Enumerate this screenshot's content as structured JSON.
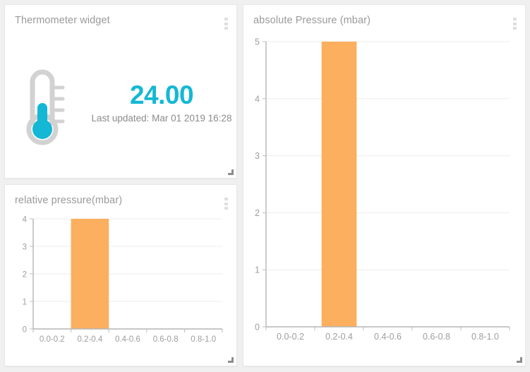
{
  "theme": {
    "page_background": "#f0f0f0",
    "card_background": "#ffffff",
    "accent_cyan": "#14b8d4",
    "bar_orange": "#fcaf5e",
    "title_gray": "#9a9a9a",
    "axis_gray": "#9d9d9d",
    "grid_gray": "#ededed",
    "menu_dot_gray": "#dcdfe2"
  },
  "cards": {
    "thermometer": {
      "title": "Thermometer widget",
      "value": "24.00",
      "last_updated": "Last updated: Mar 01 2019 16:28",
      "menu_icon": "kebab-menu-icon",
      "resize_icon": "resize-handle-icon"
    },
    "relative_pressure": {
      "title": "relative pressure(mbar)",
      "menu_icon": "kebab-menu-icon",
      "resize_icon": "resize-handle-icon"
    },
    "absolute_pressure": {
      "title": "absolute Pressure (mbar)",
      "menu_icon": "kebab-menu-icon",
      "resize_icon": "resize-handle-icon"
    }
  },
  "chart_data": [
    {
      "id": "relative-pressure-histogram",
      "type": "bar",
      "title": "relative pressure(mbar)",
      "categories": [
        "0.0-0.2",
        "0.2-0.4",
        "0.4-0.6",
        "0.6-0.8",
        "0.8-1.0"
      ],
      "values": [
        0,
        4,
        0,
        0,
        0
      ],
      "xlabel": "",
      "ylabel": "",
      "ylim": [
        0,
        4
      ],
      "yticks": [
        0,
        1,
        2,
        3,
        4
      ],
      "ytick_labels": [
        "0",
        "1",
        "2",
        "3",
        "4"
      ],
      "grid": true,
      "legend": false,
      "bar_color": "#fcaf5e"
    },
    {
      "id": "absolute-pressure-histogram",
      "type": "bar",
      "title": "absolute Pressure (mbar)",
      "categories": [
        "0.0-0.2",
        "0.2-0.4",
        "0.4-0.6",
        "0.6-0.8",
        "0.8-1.0"
      ],
      "values": [
        0,
        5,
        0,
        0,
        0
      ],
      "xlabel": "",
      "ylabel": "",
      "ylim": [
        0,
        5
      ],
      "yticks": [
        0,
        1,
        2,
        3,
        4,
        5
      ],
      "ytick_labels": [
        "0",
        "1",
        "2",
        "3",
        "4",
        "5"
      ],
      "grid": true,
      "legend": false,
      "bar_color": "#fcaf5e"
    }
  ]
}
